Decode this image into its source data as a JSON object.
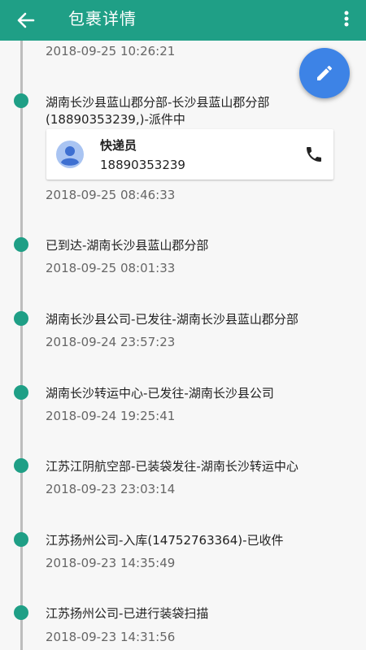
{
  "header": {
    "title": "包裹详情",
    "back_icon": "arrow-left-icon",
    "menu_icon": "more-vertical-icon"
  },
  "fab": {
    "icon": "pencil-icon",
    "color": "#3d83e6"
  },
  "theme": {
    "primary": "#1f9f86",
    "timeline_dot": "#1f9f86"
  },
  "courier": {
    "label": "快递员",
    "phone": "18890353239",
    "avatar_icon": "person-avatar-icon",
    "call_icon": "phone-icon"
  },
  "events": [
    {
      "desc": "",
      "time": "2018-09-25 10:26:21"
    },
    {
      "desc": "湖南长沙县蓝山郡分部-长沙县蓝山郡分部(18890353239,)-派件中",
      "time": "2018-09-25 08:46:33"
    },
    {
      "desc": "已到达-湖南长沙县蓝山郡分部",
      "time": "2018-09-25 08:01:33"
    },
    {
      "desc": "湖南长沙县公司-已发往-湖南长沙县蓝山郡分部",
      "time": "2018-09-24 23:57:23"
    },
    {
      "desc": "湖南长沙转运中心-已发往-湖南长沙县公司",
      "time": "2018-09-24 19:25:41"
    },
    {
      "desc": "江苏江阴航空部-已装袋发往-湖南长沙转运中心",
      "time": "2018-09-23 23:03:14"
    },
    {
      "desc": "江苏扬州公司-入库(14752763364)-已收件",
      "time": "2018-09-23 14:35:49"
    },
    {
      "desc": "江苏扬州公司-已进行装袋扫描",
      "time": "2018-09-23 14:31:56"
    }
  ]
}
